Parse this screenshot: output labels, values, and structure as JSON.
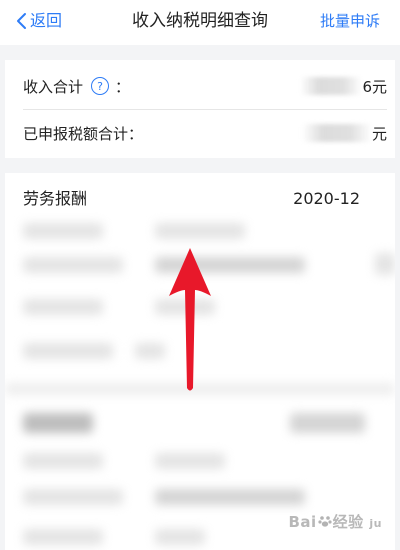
{
  "header": {
    "back_label": "返回",
    "title": "收入纳税明细查询",
    "batch_appeal_label": "批量申诉"
  },
  "summary": {
    "income_total_label": "收入合计",
    "income_total_help": "?",
    "income_total_colon": "：",
    "income_total_value_visible": "6元",
    "declared_tax_label": "已申报税额合计：",
    "declared_tax_value_visible": "元"
  },
  "record": {
    "type": "劳务报酬",
    "period": "2020-12"
  },
  "watermark": {
    "text_a": "Bai",
    "text_b": "经验",
    "text_c": "ju"
  },
  "colors": {
    "accent": "#2e7cf6",
    "arrow": "#e8182a",
    "background": "#f3f4f6"
  }
}
